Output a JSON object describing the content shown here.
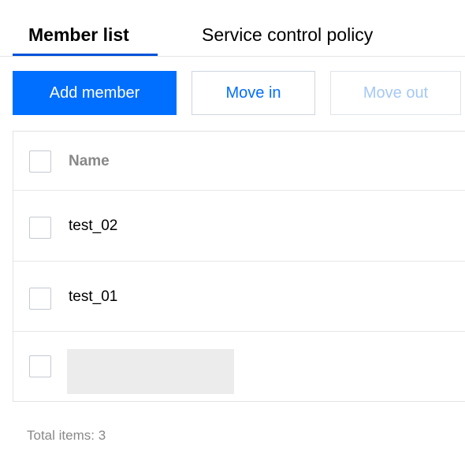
{
  "tabs": [
    {
      "label": "Member list",
      "active": true
    },
    {
      "label": "Service control policy",
      "active": false
    }
  ],
  "toolbar": {
    "add_label": "Add member",
    "move_in_label": "Move in",
    "move_out_label": "Move out"
  },
  "table": {
    "header_name": "Name",
    "rows": [
      {
        "name": "test_02"
      },
      {
        "name": "test_01"
      }
    ]
  },
  "footer": {
    "total_text": "Total items:  3"
  },
  "colors": {
    "primary": "#006eff",
    "tab_indicator": "#0052d9",
    "disabled_text": "#a5c8f5",
    "muted_text": "#888888"
  }
}
